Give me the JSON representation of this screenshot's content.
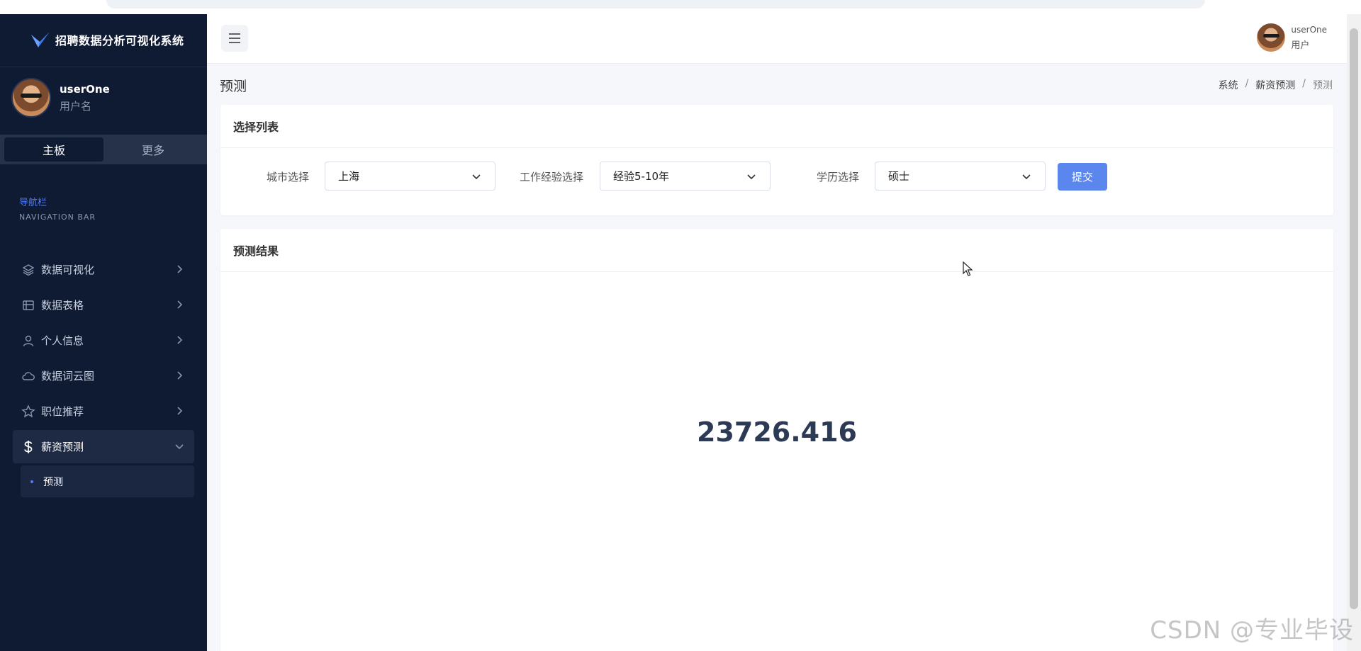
{
  "app": {
    "title": "招聘数据分析可视化系统"
  },
  "sidebar": {
    "user": {
      "name": "userOne",
      "subtitle": "用户名"
    },
    "tabs": [
      {
        "label": "主板",
        "active": true
      },
      {
        "label": "更多",
        "active": false
      }
    ],
    "nav_heading": {
      "zh": "导航栏",
      "en": "NAVIGATION BAR"
    },
    "items": [
      {
        "label": "数据可视化",
        "icon": "layers-icon"
      },
      {
        "label": "数据表格",
        "icon": "table-icon"
      },
      {
        "label": "个人信息",
        "icon": "user-icon"
      },
      {
        "label": "数据词云图",
        "icon": "cloud-icon"
      },
      {
        "label": "职位推荐",
        "icon": "star-icon"
      },
      {
        "label": "薪资预测",
        "icon": "dollar-icon",
        "expanded": true
      }
    ],
    "sub_items": [
      {
        "label": "预测",
        "active": true
      }
    ]
  },
  "topbar": {
    "user_name": "userOne",
    "user_role": "用户"
  },
  "page": {
    "title": "预测",
    "breadcrumb": [
      "系统",
      "薪资预测",
      "预测"
    ]
  },
  "select_card": {
    "header": "选择列表",
    "city": {
      "label": "城市选择",
      "value": "上海"
    },
    "experience": {
      "label": "工作经验选择",
      "value": "经验5-10年"
    },
    "education": {
      "label": "学历选择",
      "value": "硕士"
    },
    "submit_label": "提交"
  },
  "result_card": {
    "header": "预测结果",
    "value": "23726.416"
  },
  "watermark": "CSDN @专业毕设",
  "colors": {
    "sidebar_bg": "#0f1a33",
    "accent": "#5b86ee",
    "result_text": "#2d3a55"
  }
}
